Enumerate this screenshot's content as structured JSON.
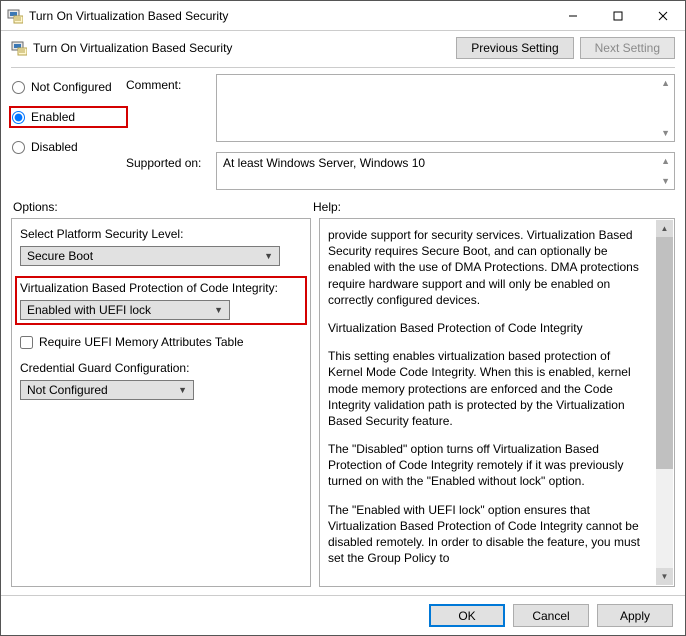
{
  "window": {
    "title": "Turn On Virtualization Based Security"
  },
  "header": {
    "titleText": "Turn On Virtualization Based Security",
    "prev": "Previous Setting",
    "next": "Next Setting"
  },
  "config": {
    "radios": {
      "notConfigured": "Not Configured",
      "enabled": "Enabled",
      "disabled": "Disabled",
      "selected": "Enabled"
    },
    "commentLabel": "Comment:",
    "commentValue": "",
    "supportedLabel": "Supported on:",
    "supportedValue": "At least Windows Server, Windows 10"
  },
  "labels": {
    "options": "Options:",
    "help": "Help:"
  },
  "options": {
    "platformLabel": "Select Platform Security Level:",
    "platformValue": "Secure Boot",
    "vbpciLabel": "Virtualization Based Protection of Code Integrity:",
    "vbpciValue": "Enabled with UEFI lock",
    "uefiCheckbox": "Require UEFI Memory Attributes Table",
    "credGuardLabel": "Credential Guard Configuration:",
    "credGuardValue": "Not Configured"
  },
  "help": {
    "p1": "provide support for security services. Virtualization Based Security requires Secure Boot, and can optionally be enabled with the use of DMA Protections. DMA protections require hardware support and will only be enabled on correctly configured devices.",
    "p2": "Virtualization Based Protection of Code Integrity",
    "p3": "This setting enables virtualization based protection of Kernel Mode Code Integrity. When this is enabled, kernel mode memory protections are enforced and the Code Integrity validation path is protected by the Virtualization Based Security feature.",
    "p4": "The \"Disabled\" option turns off Virtualization Based Protection of Code Integrity remotely if it was previously turned on with the \"Enabled without lock\" option.",
    "p5": "The \"Enabled with UEFI lock\" option ensures that Virtualization Based Protection of Code Integrity cannot be disabled remotely. In order to disable the feature, you must set the Group Policy to"
  },
  "buttons": {
    "ok": "OK",
    "cancel": "Cancel",
    "apply": "Apply"
  }
}
